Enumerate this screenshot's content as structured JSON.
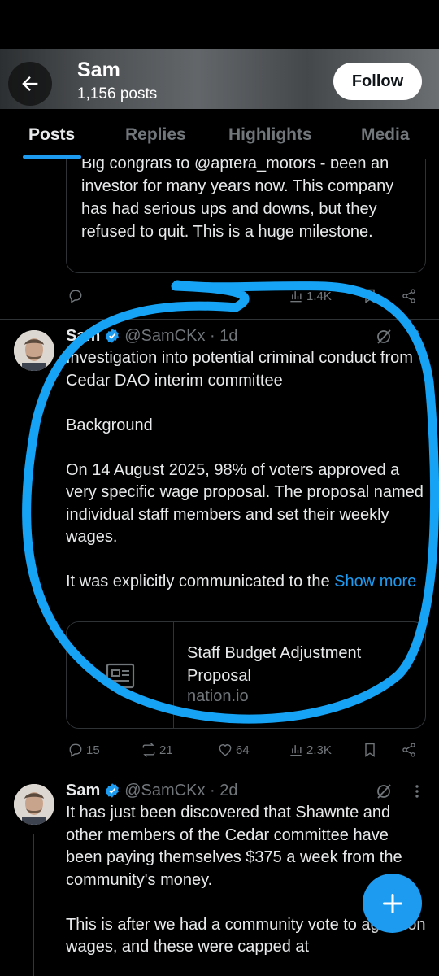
{
  "header": {
    "name": "Sam",
    "posts_count": "1,156 posts",
    "follow_label": "Follow"
  },
  "tabs": [
    "Posts",
    "Replies",
    "Highlights",
    "Media"
  ],
  "quoted_post": {
    "text": "Big congrats to @aptera_motors - been an investor for many years now. This company has had serious ups and downs, but they refused to quit. This is a huge milestone.",
    "views": "1.4K"
  },
  "post1": {
    "name": "Sam",
    "handle_time": "@SamCKx · 1d",
    "paragraphs": [
      "Investigation into potential criminal conduct from Cedar DAO interim committee",
      "Background",
      "On 14 August 2025, 98% of voters approved a very specific wage proposal. The proposal named individual staff members and set their weekly wages."
    ],
    "last_paragraph": "It was explicitly communicated to the ",
    "show_more": "Show more",
    "link_card": {
      "title": "Staff Budget Adjustment Proposal",
      "domain": "nation.io"
    },
    "replies": "15",
    "reposts": "21",
    "likes": "64",
    "views": "2.3K"
  },
  "post2": {
    "name": "Sam",
    "handle_time": "@SamCKx · 2d",
    "paragraphs": [
      "It has just been discovered that Shawnte and other members of the Cedar committee have been paying themselves $375 a week from the community's money.",
      "This is after we had a community vote to agree on wages, and these were capped at"
    ]
  },
  "colors": {
    "accent": "#1d9bf0",
    "annotation": "#16a3f5"
  },
  "icons": [
    "back-arrow-icon",
    "verified-badge-icon",
    "grok-icon",
    "more-icon",
    "reply-icon",
    "repost-icon",
    "like-icon",
    "views-icon",
    "bookmark-icon",
    "share-icon",
    "article-icon",
    "compose-plus-icon"
  ]
}
